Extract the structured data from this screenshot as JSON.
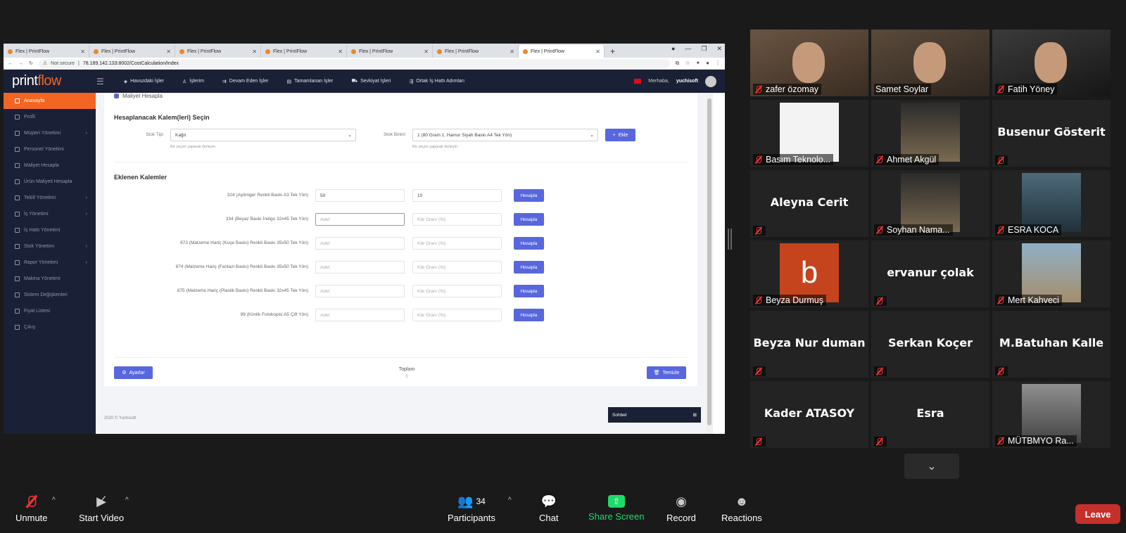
{
  "browser": {
    "tabs": [
      {
        "title": "Flex | PrintFlow"
      },
      {
        "title": "Flex | PrintFlow"
      },
      {
        "title": "Flex | PrintFlow"
      },
      {
        "title": "Flex | PrintFlow"
      },
      {
        "title": "Flex | PrintFlow"
      },
      {
        "title": "Flex | PrintFlow"
      },
      {
        "title": "Flex | PrintFlow"
      }
    ],
    "security": "Not secure",
    "url": "78.189.142.133:8002/CostCalculation/Index"
  },
  "app": {
    "logo_main": "print",
    "logo_accent": "flow",
    "nav": [
      {
        "label": "Havuzdaki İşler",
        "icon": "pool-icon"
      },
      {
        "label": "İşlerim",
        "icon": "user-icon"
      },
      {
        "label": "Devam Eden İşler",
        "icon": "progress-icon"
      },
      {
        "label": "Tamamlanan İşler",
        "icon": "calendar-icon"
      },
      {
        "label": "Sevkiyat İşleri",
        "icon": "truck-icon"
      },
      {
        "label": "Ortak İş Hattı Adımları",
        "icon": "steps-icon"
      }
    ],
    "greeting": "Merhaba,",
    "username": "yuchisoft",
    "sidebar": [
      {
        "label": "Anasayfa",
        "active": true
      },
      {
        "label": "Profil"
      },
      {
        "label": "Müşteri Yönetimi",
        "chevron": true
      },
      {
        "label": "Personel Yönetimi"
      },
      {
        "label": "Maliyet Hesapla"
      },
      {
        "label": "Ürün Maliyeti Hesapla"
      },
      {
        "label": "Teklif Yönetimi",
        "chevron": true
      },
      {
        "label": "İş Yönetimi",
        "chevron": true
      },
      {
        "label": "İş Hattı Yönetimi"
      },
      {
        "label": "Stok Yönetimi",
        "chevron": true
      },
      {
        "label": "Rapor Yönetimi",
        "chevron": true
      },
      {
        "label": "Makina Yönetimi"
      },
      {
        "label": "Sistem Değişkenleri"
      },
      {
        "label": "Fiyat Listesi"
      },
      {
        "label": "Çıkış"
      }
    ],
    "panel_title": "Maliyet Hesapla",
    "select_section": "Hesaplanacak Kalem(leri) Seçin",
    "stock_type_label": "Stok Tipi",
    "stock_type_value": "Kağıt",
    "stock_unit_label": "Stok Birimi",
    "stock_unit_value": "1 (80 Gram 1. Hamur Siyah Baskı A4 Tek Yön)",
    "select_hint": "Bir seçim yaparak ilerleyin",
    "add_label": "Ekle",
    "added_section": "Eklenen Kalemler",
    "rows": [
      {
        "label": "324 (Aydınger Renkli Baskı A3 Tek Yön)",
        "qty": "50",
        "qty_ph": "Adet",
        "margin": "10",
        "margin_ph": "Kâr Oranı (%)"
      },
      {
        "label": "334 (Beyaz Baskı İndigo 32x45 Tek Yön)",
        "qty": "",
        "qty_ph": "Adet",
        "margin": "",
        "margin_ph": "Kâr Oranı (%)"
      },
      {
        "label": "873 (Malzeme Hariç (Kuşe Baskı) Renkli Baskı 35x50 Tek Yön)",
        "qty": "",
        "qty_ph": "Adet",
        "margin": "",
        "margin_ph": "Kâr Oranı (%)"
      },
      {
        "label": "874 (Malzeme Hariç (Fantazi Baskı) Renkli Baskı 35x50 Tek Yön)",
        "qty": "",
        "qty_ph": "Adet",
        "margin": "",
        "margin_ph": "Kâr Oranı (%)"
      },
      {
        "label": "875 (Malzeme Hariç (Plastik Baskı) Renkli Baskı 32x45 Tek Yön)",
        "qty": "",
        "qty_ph": "Adet",
        "margin": "",
        "margin_ph": "Kâr Oranı (%)"
      },
      {
        "label": "99 (Kimlik Fotokopisi A5 Çift Yön)",
        "qty": "",
        "qty_ph": "Adet",
        "margin": "",
        "margin_ph": "Kâr Oranı (%)"
      }
    ],
    "calc_label": "Hesapla",
    "settings_label": "Ayarlar",
    "total_label": "Toplam",
    "total_value": "0",
    "clear_label": "Temizle",
    "footer": "2020 © Yuchisoft",
    "chat_label": "Sohbet"
  },
  "zoom": {
    "participants": [
      {
        "name": "zafer özomay",
        "video": "b"
      },
      {
        "name": "Samet Soylar",
        "video": "a",
        "speaking": true
      },
      {
        "name": "Fatih Yöney",
        "video": "c"
      },
      {
        "name": "Basım Teknolo...",
        "pic": "logo"
      },
      {
        "name": "Ahmet Akgül",
        "pic": "dark"
      },
      {
        "name": "",
        "big": "Busenur Gösterit"
      },
      {
        "name": "",
        "big": "Aleyna Cerit"
      },
      {
        "name": "Soyhan Nama...",
        "pic": "dark"
      },
      {
        "name": "ESRA KOCA",
        "pic": "photo"
      },
      {
        "name": "Beyza Durmuş",
        "pic": "red",
        "letter": "b"
      },
      {
        "name": "",
        "big": "ervanur çolak"
      },
      {
        "name": "Mert Kahveci",
        "pic": "sea"
      },
      {
        "name": "",
        "big": "Beyza Nur duman"
      },
      {
        "name": "",
        "big": "Serkan Koçer"
      },
      {
        "name": "",
        "big": "M.Batuhan Kalle"
      },
      {
        "name": "",
        "big": "Kader ATASOY"
      },
      {
        "name": "",
        "big": "Esra"
      },
      {
        "name": "MÜTBMYO Ra...",
        "pic": "train"
      }
    ],
    "toolbar": {
      "unmute": "Unmute",
      "start_video": "Start Video",
      "participants": "Participants",
      "participant_count": "34",
      "chat": "Chat",
      "share_screen": "Share Screen",
      "record": "Record",
      "reactions": "Reactions",
      "leave": "Leave"
    }
  }
}
